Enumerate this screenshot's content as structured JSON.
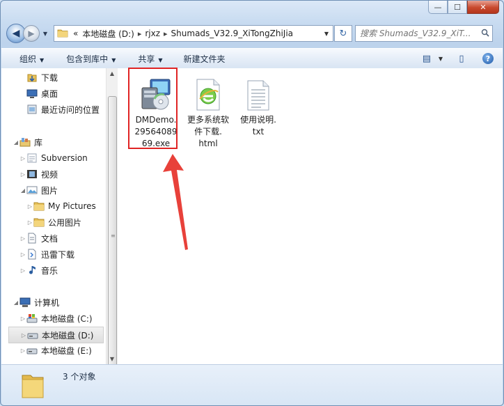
{
  "window": {
    "caption_buttons": {
      "minimize": "—",
      "maximize": "☐",
      "close": "✕"
    }
  },
  "nav": {
    "back_glyph": "◀",
    "forward_glyph": "▶",
    "address": {
      "prefix": "«",
      "segments": [
        "本地磁盘 (D:)",
        "rjxz",
        "Shumads_V32.9_XiTongZhiJia"
      ],
      "separator": "▸"
    },
    "refresh_glyph": "↻",
    "search_placeholder": "搜索 Shumads_V32.9_XiT...",
    "search_icon": "search-icon"
  },
  "toolbar": {
    "organize": "组织",
    "include_library": "包含到库中",
    "share": "共享",
    "new_folder": "新建文件夹",
    "views_glyph": "▤",
    "preview_glyph": "▯",
    "help_glyph": "?"
  },
  "sidebar": {
    "items": [
      {
        "label": "下载",
        "icon": "downloads-folder-icon",
        "indent": 1,
        "arrow": ""
      },
      {
        "label": "桌面",
        "icon": "desktop-icon",
        "indent": 1,
        "arrow": ""
      },
      {
        "label": "最近访问的位置",
        "icon": "recent-places-icon",
        "indent": 1,
        "arrow": ""
      },
      {
        "label": "库",
        "icon": "libraries-icon",
        "indent": 0,
        "arrow": "◢"
      },
      {
        "label": "Subversion",
        "icon": "subversion-library-icon",
        "indent": 1,
        "arrow": "▷"
      },
      {
        "label": "视频",
        "icon": "videos-library-icon",
        "indent": 1,
        "arrow": "▷"
      },
      {
        "label": "图片",
        "icon": "pictures-library-icon",
        "indent": 1,
        "arrow": "◢"
      },
      {
        "label": "My Pictures",
        "icon": "folder-icon",
        "indent": 2,
        "arrow": "▷"
      },
      {
        "label": "公用图片",
        "icon": "folder-icon",
        "indent": 2,
        "arrow": "▷"
      },
      {
        "label": "文档",
        "icon": "documents-library-icon",
        "indent": 1,
        "arrow": "▷"
      },
      {
        "label": "迅雷下载",
        "icon": "thunder-download-icon",
        "indent": 1,
        "arrow": "▷"
      },
      {
        "label": "音乐",
        "icon": "music-library-icon",
        "indent": 1,
        "arrow": "▷"
      },
      {
        "label": "计算机",
        "icon": "computer-icon",
        "indent": 0,
        "arrow": "◢"
      },
      {
        "label": "本地磁盘 (C:)",
        "icon": "system-drive-icon",
        "indent": 1,
        "arrow": "▷"
      },
      {
        "label": "本地磁盘 (D:)",
        "icon": "drive-icon",
        "indent": 1,
        "arrow": "▷",
        "selected": true
      },
      {
        "label": "本地磁盘 (E:)",
        "icon": "drive-icon",
        "indent": 1,
        "arrow": "▷"
      }
    ]
  },
  "files": [
    {
      "name": "DMDemo.2956408969.exe",
      "icon": "installer-exe-icon",
      "lines": [
        "DMDemo.",
        "29564089",
        "69.exe"
      ],
      "highlighted": true
    },
    {
      "name": "更多系统软件下载.html",
      "icon": "html-ie-file-icon",
      "lines": [
        "更多系统软",
        "件下载.",
        "html"
      ]
    },
    {
      "name": "使用说明.txt",
      "icon": "text-file-icon",
      "lines": [
        "使用说明.",
        "txt"
      ]
    }
  ],
  "status": {
    "count_text": "3 个对象"
  },
  "colors": {
    "highlight_box": "#e02424",
    "annotation_arrow": "#e8413a",
    "selection": "#dedede"
  }
}
